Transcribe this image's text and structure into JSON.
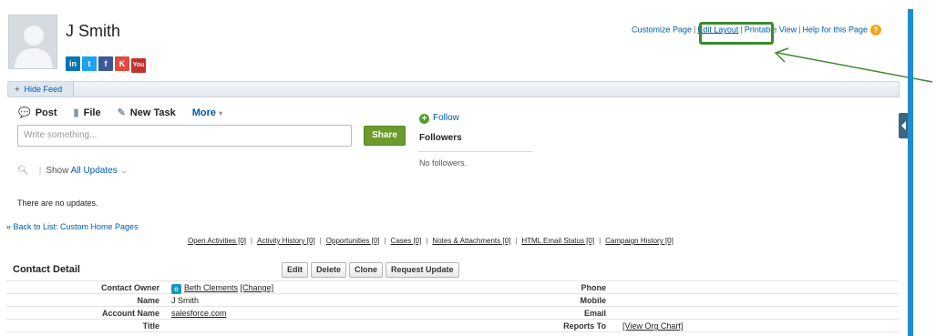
{
  "header": {
    "contact_name": "J Smith",
    "social_icons": [
      {
        "name": "linkedin-icon",
        "glyph": "in",
        "color": "#0077b5"
      },
      {
        "name": "twitter-icon",
        "glyph": "t",
        "color": "#1da1f2"
      },
      {
        "name": "facebook-icon",
        "glyph": "f",
        "color": "#3b5998"
      },
      {
        "name": "klout-icon",
        "glyph": "K",
        "color": "#e44a3e"
      },
      {
        "name": "youtube-icon",
        "glyph": "You",
        "color": "#c4302b"
      }
    ],
    "links": {
      "customize_page": "Customize Page",
      "edit_layout": "Edit Layout",
      "printable_view": "Printable View",
      "help": "Help for this Page"
    }
  },
  "feed": {
    "hide_feed": "Hide Feed",
    "publisher_tabs": {
      "post": "Post",
      "file": "File",
      "new_task": "New Task",
      "more": "More"
    },
    "post_placeholder": "Write something...",
    "share": "Share",
    "follow": "Follow",
    "followers_title": "Followers",
    "no_followers": "No followers.",
    "show": "Show",
    "all_updates": "All Updates",
    "no_updates": "There are no updates."
  },
  "nav": {
    "back_link": "« Back to List: Custom Home Pages"
  },
  "related_lists": [
    "Open Activities [0]",
    "Activity History [0]",
    "Opportunities [0]",
    "Cases [0]",
    "Notes & Attachments [0]",
    "HTML Email Status [0]",
    "Campaign History [0]"
  ],
  "contact_detail": {
    "title": "Contact Detail",
    "buttons": {
      "edit": "Edit",
      "delete": "Delete",
      "clone": "Clone",
      "request_update": "Request Update"
    },
    "contact_owner_label": "Contact Owner",
    "contact_owner_value": "Beth Clements",
    "change_link": "[Change]",
    "name_label": "Name",
    "name_value": "J Smith",
    "account_name_label": "Account Name",
    "account_name_value": "salesforce.com",
    "title_label": "Title",
    "phone_label": "Phone",
    "mobile_label": "Mobile",
    "email_label": "Email",
    "reports_to_label": "Reports To",
    "reports_to_value": "[View Org Chart]"
  },
  "colors": {
    "link": "#015ba7",
    "share_button": "#6c9a2d",
    "highlight": "#3c8a2e",
    "side_bar": "#1f8ccf"
  }
}
